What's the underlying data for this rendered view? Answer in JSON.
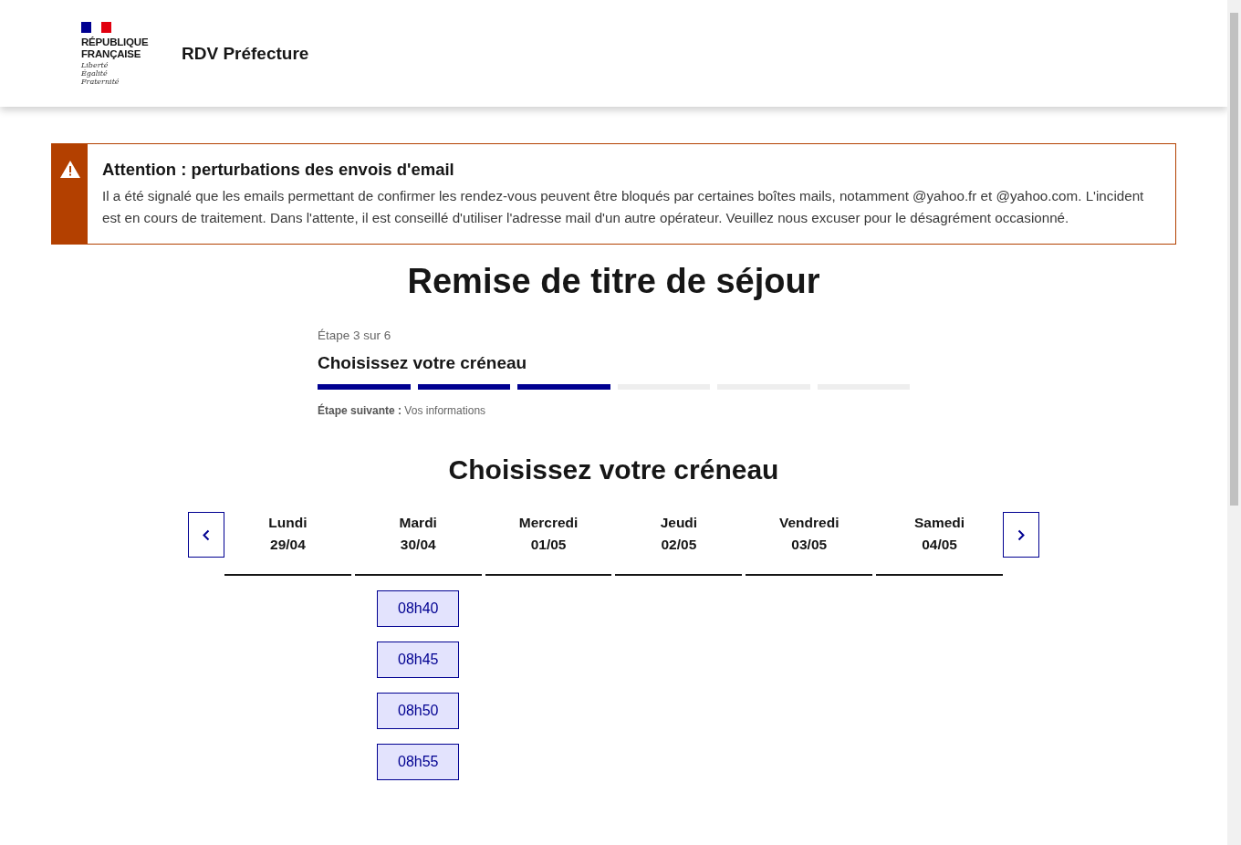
{
  "header": {
    "logo_lines": [
      "RÉPUBLIQUE",
      "FRANÇAISE"
    ],
    "motto": [
      "Liberté",
      "Égalité",
      "Fraternité"
    ],
    "service_name": "RDV Préfecture"
  },
  "alert": {
    "title": "Attention : perturbations des envois d'email",
    "text": "Il a été signalé que les emails permettant de confirmer les rendez-vous peuvent être bloqués par certaines boîtes mails, notamment @yahoo.fr et @yahoo.com. L'incident est en cours de traitement. Dans l'attente, il est conseillé d'utiliser l'adresse mail d'un autre opérateur. Veuillez nous excuser pour le désagrément occasionné."
  },
  "page_title": "Remise de titre de séjour",
  "stepper": {
    "step_label": "Étape 3 sur 6",
    "current_title": "Choisissez votre créneau",
    "segments": [
      {
        "done": true
      },
      {
        "done": true
      },
      {
        "done": true
      },
      {
        "done": false
      },
      {
        "done": false
      },
      {
        "done": false
      }
    ],
    "next_label": "Étape suivante :",
    "next_title": "Vos informations"
  },
  "calendar": {
    "title": "Choisissez votre créneau",
    "days": [
      {
        "day": "Lundi",
        "date": "29/04"
      },
      {
        "day": "Mardi",
        "date": "30/04",
        "slots": [
          "08h40",
          "08h45",
          "08h50",
          "08h55"
        ]
      },
      {
        "day": "Mercredi",
        "date": "01/05"
      },
      {
        "day": "Jeudi",
        "date": "02/05"
      },
      {
        "day": "Vendredi",
        "date": "03/05"
      },
      {
        "day": "Samedi",
        "date": "04/05"
      }
    ]
  }
}
